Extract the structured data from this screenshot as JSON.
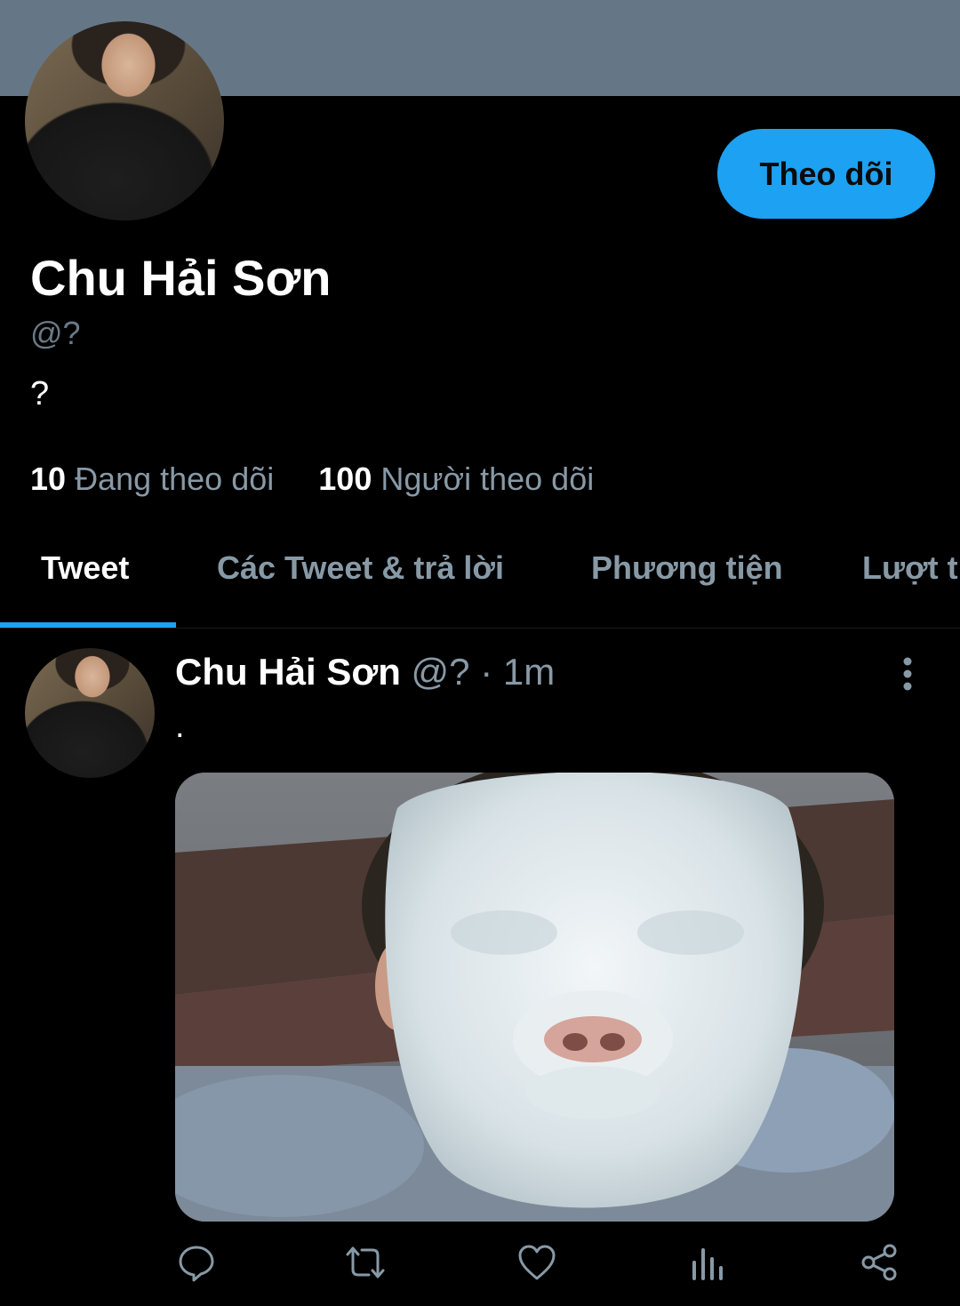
{
  "header": {
    "banner_color": "#657786",
    "follow_button_label": "Theo dõi"
  },
  "profile": {
    "name": "Chu Hải Sơn",
    "handle": "@?",
    "bio": "?",
    "following_count": "10",
    "following_label": "Đang theo dõi",
    "followers_count": "100",
    "followers_label": "Người theo dõi"
  },
  "tabs": [
    {
      "label": "Tweet",
      "active": true
    },
    {
      "label": "Các Tweet & trả lời",
      "active": false
    },
    {
      "label": "Phương tiện",
      "active": false
    },
    {
      "label": "Lượt thích",
      "active": false
    }
  ],
  "tweet": {
    "author_name": "Chu Hải Sơn",
    "author_handle": "@?",
    "separator": "·",
    "time": "1m",
    "text": ".",
    "media": "photo-face-mask"
  },
  "actions": [
    "reply-icon",
    "retweet-icon",
    "like-icon",
    "analytics-icon",
    "share-icon"
  ],
  "colors": {
    "accent": "#1da1f2",
    "muted": "#8899a6",
    "background": "#000000"
  }
}
